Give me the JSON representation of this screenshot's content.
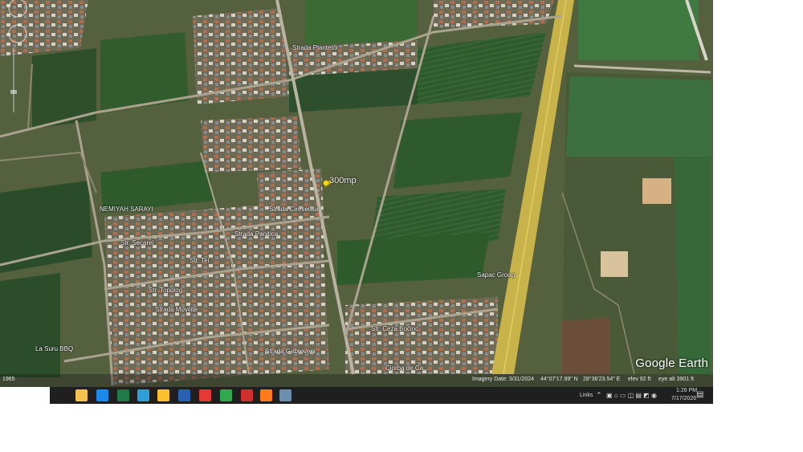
{
  "map": {
    "pin_label": "300mp",
    "place_labels": [
      {
        "text": "NEMIYAH SARAYI"
      },
      {
        "text": "Str. Secarei"
      },
      {
        "text": "Str. Topolog"
      },
      {
        "text": "Strada Movilite"
      },
      {
        "text": "La Suru BBQ"
      },
      {
        "text": "Strada Gabroveni"
      },
      {
        "text": "Str. Ceza Bocioc"
      },
      {
        "text": "Ciorba de Ca..."
      },
      {
        "text": "Sapac Group"
      },
      {
        "text": "Strada Plantelor"
      },
      {
        "text": "Strada Panitica"
      },
      {
        "text": "Strada Cireseului"
      },
      {
        "text": "Str. Tei"
      }
    ],
    "brand": "Google Earth",
    "scale_label": "1965"
  },
  "status_bar": {
    "imagery_date": "Imagery Date: 3/31/2024",
    "lat": "44°07'17.99\" N",
    "lon": "28°36'23.54\" E",
    "elev": "elev  92 ft",
    "eye_alt": "eye alt  3901 ft"
  },
  "taskbar": {
    "apps": [
      {
        "name": "File Explorer",
        "icon": "folder-icon",
        "color": "#f2c14e"
      },
      {
        "name": "Microsoft Edge",
        "icon": "edge-icon",
        "color": "#1e88e5"
      },
      {
        "name": "Excel",
        "icon": "excel-icon",
        "color": "#1e7b45"
      },
      {
        "name": "Image viewer",
        "icon": "photo-app-icon",
        "color": "#2e9fd8"
      },
      {
        "name": "Google Chrome",
        "icon": "chrome-icon",
        "color": "#fbc02d"
      },
      {
        "name": "Word",
        "icon": "word-icon",
        "color": "#2b5fb4"
      },
      {
        "name": "PDF reader",
        "icon": "pdf-icon",
        "color": "#e53935"
      },
      {
        "name": "Green app",
        "icon": "green-l-icon",
        "color": "#2fa84f"
      },
      {
        "name": "Acrobat",
        "icon": "acrobat-icon",
        "color": "#d32f2f"
      },
      {
        "name": "Firefox",
        "icon": "firefox-icon",
        "color": "#ff7a1a"
      },
      {
        "name": "Google Earth",
        "icon": "google-earth-icon",
        "color": "#6c8fb0"
      }
    ],
    "links_label": "Links",
    "time": "1:26 PM",
    "date": "7/17/2026"
  }
}
